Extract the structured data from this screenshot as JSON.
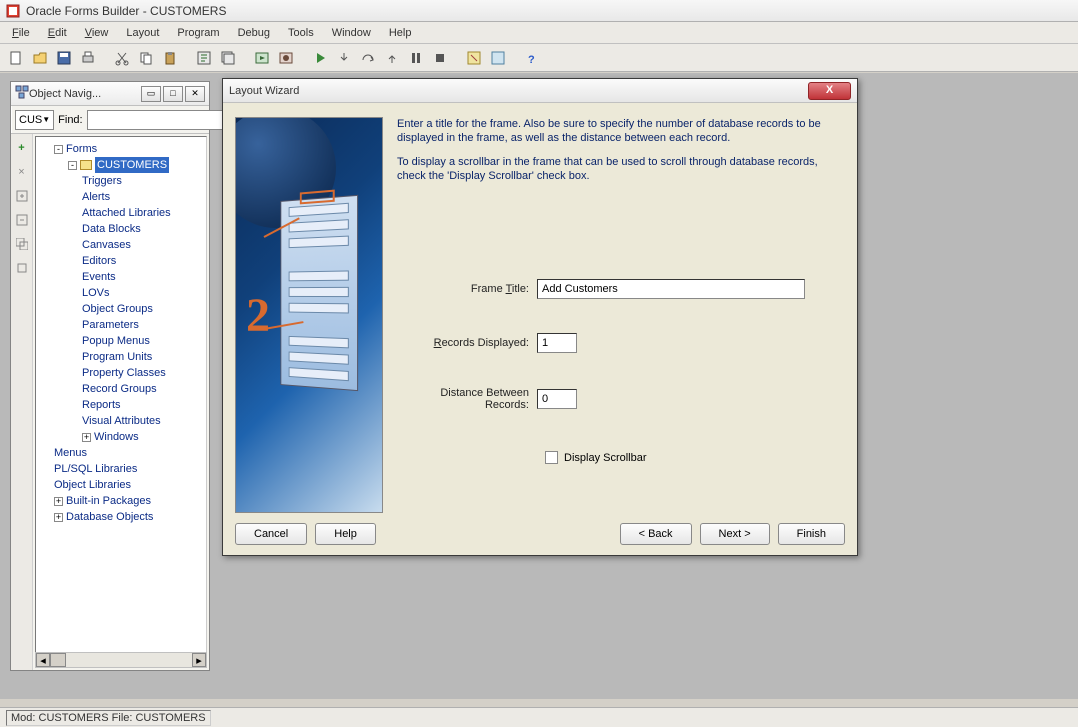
{
  "app": {
    "title": "Oracle Forms Builder - CUSTOMERS"
  },
  "menu": {
    "file": "File",
    "edit": "Edit",
    "view": "View",
    "layout": "Layout",
    "program": "Program",
    "debug": "Debug",
    "tools": "Tools",
    "window": "Window",
    "help": "Help"
  },
  "navigator": {
    "title": "Object Navig...",
    "select_value": "CUS",
    "find_label": "Find:",
    "find_value": "",
    "nodes": {
      "forms": "Forms",
      "customers": "CUSTOMERS",
      "triggers": "Triggers",
      "alerts": "Alerts",
      "attached_libraries": "Attached Libraries",
      "data_blocks": "Data Blocks",
      "canvases": "Canvases",
      "editors": "Editors",
      "events": "Events",
      "lovs": "LOVs",
      "object_groups": "Object Groups",
      "parameters": "Parameters",
      "popup_menus": "Popup Menus",
      "program_units": "Program Units",
      "property_classes": "Property Classes",
      "record_groups": "Record Groups",
      "reports": "Reports",
      "visual_attributes": "Visual Attributes",
      "windows": "Windows",
      "menus": "Menus",
      "plsql_libraries": "PL/SQL Libraries",
      "object_libraries": "Object Libraries",
      "builtin_packages": "Built-in Packages",
      "database_objects": "Database Objects"
    }
  },
  "wizard": {
    "title": "Layout Wizard",
    "para1": "Enter a title for the frame. Also be sure to specify the number of database records to be displayed in the frame, as well as the distance between each record.",
    "para2": "To display a scrollbar in the frame that can be used to scroll through database records, check the 'Display Scrollbar' check box.",
    "frame_title_label": "Frame Title:",
    "frame_title_value": "Add Customers",
    "records_label": "Records Displayed:",
    "records_value": "1",
    "distance_label": "Distance Between Records:",
    "distance_value": "0",
    "scrollbar_label": "Display Scrollbar",
    "buttons": {
      "cancel": "Cancel",
      "help": "Help",
      "back": "< Back",
      "next": "Next >",
      "finish": "Finish"
    }
  },
  "status": {
    "mod": "Mod: CUSTOMERS",
    "file": "File: CUSTOMERS"
  }
}
